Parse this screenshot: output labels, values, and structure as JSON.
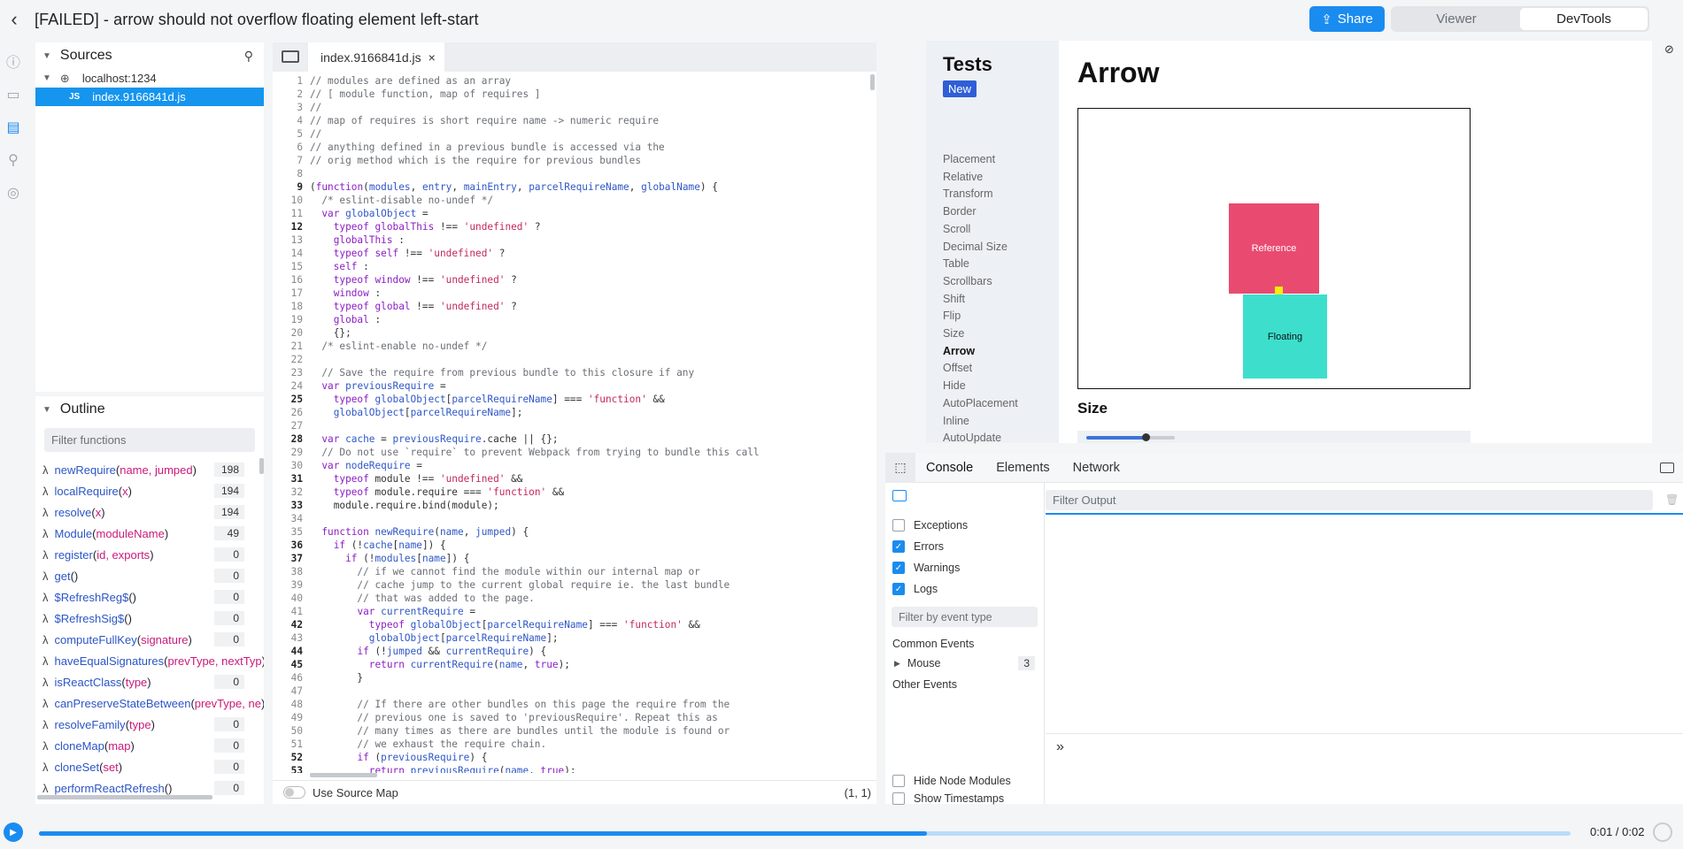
{
  "header": {
    "title": "[FAILED] - arrow should not overflow floating element left-start",
    "share_label": "Share",
    "mode_tabs": [
      "Viewer",
      "DevTools"
    ],
    "active_mode": "DevTools"
  },
  "sources": {
    "heading": "Sources",
    "host": "localhost:1234",
    "file": "index.9166841d.js",
    "file_badge": "JS"
  },
  "outline": {
    "heading": "Outline",
    "filter_placeholder": "Filter functions",
    "items": [
      {
        "name": "newRequire",
        "params": "name, jumped",
        "count": "198"
      },
      {
        "name": "localRequire",
        "params": "x",
        "count": "194"
      },
      {
        "name": "resolve",
        "params": "x",
        "count": "194"
      },
      {
        "name": "Module",
        "params": "moduleName",
        "count": "49"
      },
      {
        "name": "register",
        "params": "id, exports",
        "count": "0"
      },
      {
        "name": "get",
        "params": "",
        "count": "0"
      },
      {
        "name": "$RefreshReg$",
        "params": "",
        "count": "0"
      },
      {
        "name": "$RefreshSig$",
        "params": "",
        "count": "0"
      },
      {
        "name": "computeFullKey",
        "params": "signature",
        "count": "0"
      },
      {
        "name": "haveEqualSignatures",
        "params": "prevType, nextTyp",
        "count": ""
      },
      {
        "name": "isReactClass",
        "params": "type",
        "count": "0"
      },
      {
        "name": "canPreserveStateBetween",
        "params": "prevType, ne",
        "count": ""
      },
      {
        "name": "resolveFamily",
        "params": "type",
        "count": "0"
      },
      {
        "name": "cloneMap",
        "params": "map",
        "count": "0"
      },
      {
        "name": "cloneSet",
        "params": "set",
        "count": "0"
      },
      {
        "name": "performReactRefresh",
        "params": "",
        "count": "0"
      }
    ]
  },
  "editor": {
    "tab_label": "index.9166841d.js",
    "source_map_label": "Use Source Map",
    "cursor_position": "(1, 1)"
  },
  "viewer": {
    "tests_title": "Tests",
    "new_badge": "New",
    "nav": [
      "Placement",
      "Relative",
      "Transform",
      "Border",
      "Scroll",
      "Decimal Size",
      "Table",
      "Scrollbars",
      "Shift",
      "Flip",
      "Size",
      "Arrow",
      "Offset",
      "Hide",
      "AutoPlacement",
      "Inline",
      "AutoUpdate"
    ],
    "active_nav": "Arrow",
    "page_title": "Arrow",
    "reference_label": "Reference",
    "floating_label": "Floating",
    "size_heading": "Size",
    "reference_color": "#e94b70",
    "floating_color": "#3ddfcc",
    "arrow_color": "#f5ec11"
  },
  "devtools": {
    "tabs": [
      "Console",
      "Elements",
      "Network"
    ],
    "active_tab": "Console",
    "filter_output_placeholder": "Filter Output",
    "filters": [
      {
        "label": "Exceptions",
        "checked": false
      },
      {
        "label": "Errors",
        "checked": true
      },
      {
        "label": "Warnings",
        "checked": true
      },
      {
        "label": "Logs",
        "checked": true
      }
    ],
    "filter_event_placeholder": "Filter by event type",
    "common_events_label": "Common Events",
    "mouse_label": "Mouse",
    "mouse_count": "3",
    "other_events_label": "Other Events",
    "hide_node_modules": "Hide Node Modules",
    "show_timestamps": "Show Timestamps",
    "prompt_symbol": "»"
  },
  "playback": {
    "time": "0:01 / 0:02",
    "progress": 0.58,
    "accent_color": "#1a8cf0"
  }
}
